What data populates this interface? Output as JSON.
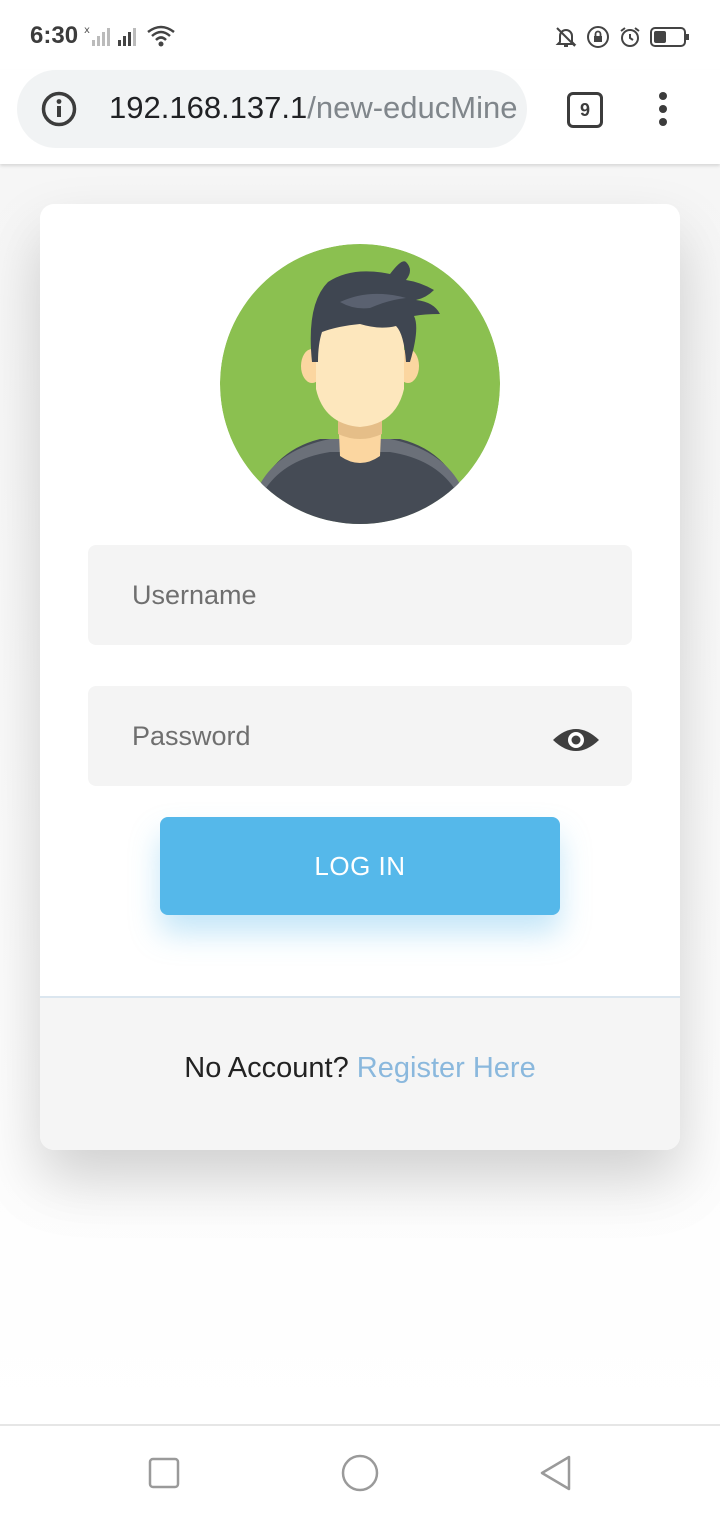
{
  "status_bar": {
    "time": "6:30"
  },
  "browser": {
    "url_host": "192.168.137.1",
    "url_path": "/new-educMine",
    "tab_count": "9"
  },
  "login": {
    "username_placeholder": "Username",
    "password_placeholder": "Password",
    "login_label": "LOG IN",
    "footer_prompt": "No Account?",
    "register_link": "Register Here"
  },
  "colors": {
    "accent": "#55b8ea",
    "link": "#8ab8dd",
    "avatar_bg": "#8bc050"
  },
  "icons": [
    "info-icon",
    "eye-icon",
    "avatar-icon",
    "recents-icon",
    "home-icon",
    "back-icon"
  ]
}
